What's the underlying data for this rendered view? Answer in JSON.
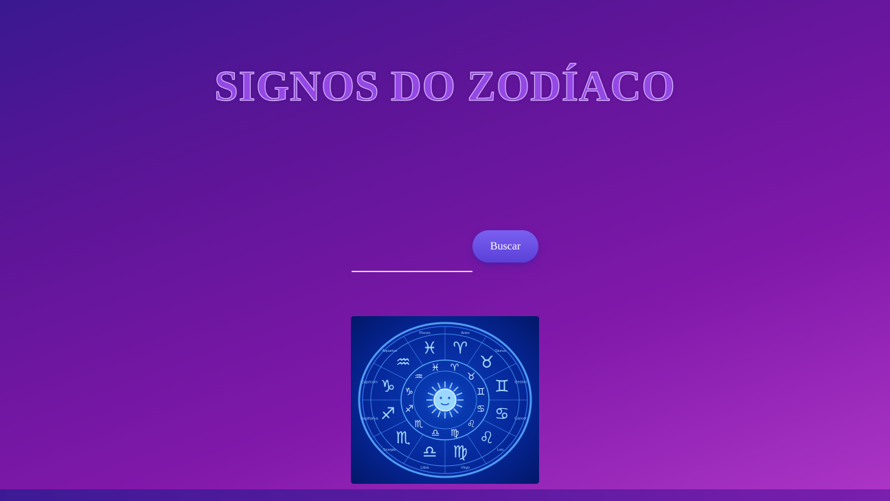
{
  "header": {
    "title": "SIGNOS DO ZODÍACO"
  },
  "search": {
    "value": "",
    "placeholder": "",
    "button_label": "Buscar"
  },
  "zodiac_image": {
    "alt": "zodiac-wheel-image",
    "sign_labels": [
      "Aries",
      "Taurus",
      "Gemini",
      "Cancer",
      "Leo",
      "Virgo",
      "Libra",
      "Scorpio",
      "Sagittarius",
      "Capricorn",
      "Aquarius",
      "Pisces"
    ],
    "sign_glyphs": [
      "♈",
      "♉",
      "♊",
      "♋",
      "♌",
      "♍",
      "♎",
      "♏",
      "♐",
      "♑",
      "♒",
      "♓"
    ]
  },
  "colors": {
    "title_fill": "#9448e4",
    "title_outline": "#d9b8ff",
    "button": "#6a50e6",
    "input_underline": "#e7c9f2"
  }
}
